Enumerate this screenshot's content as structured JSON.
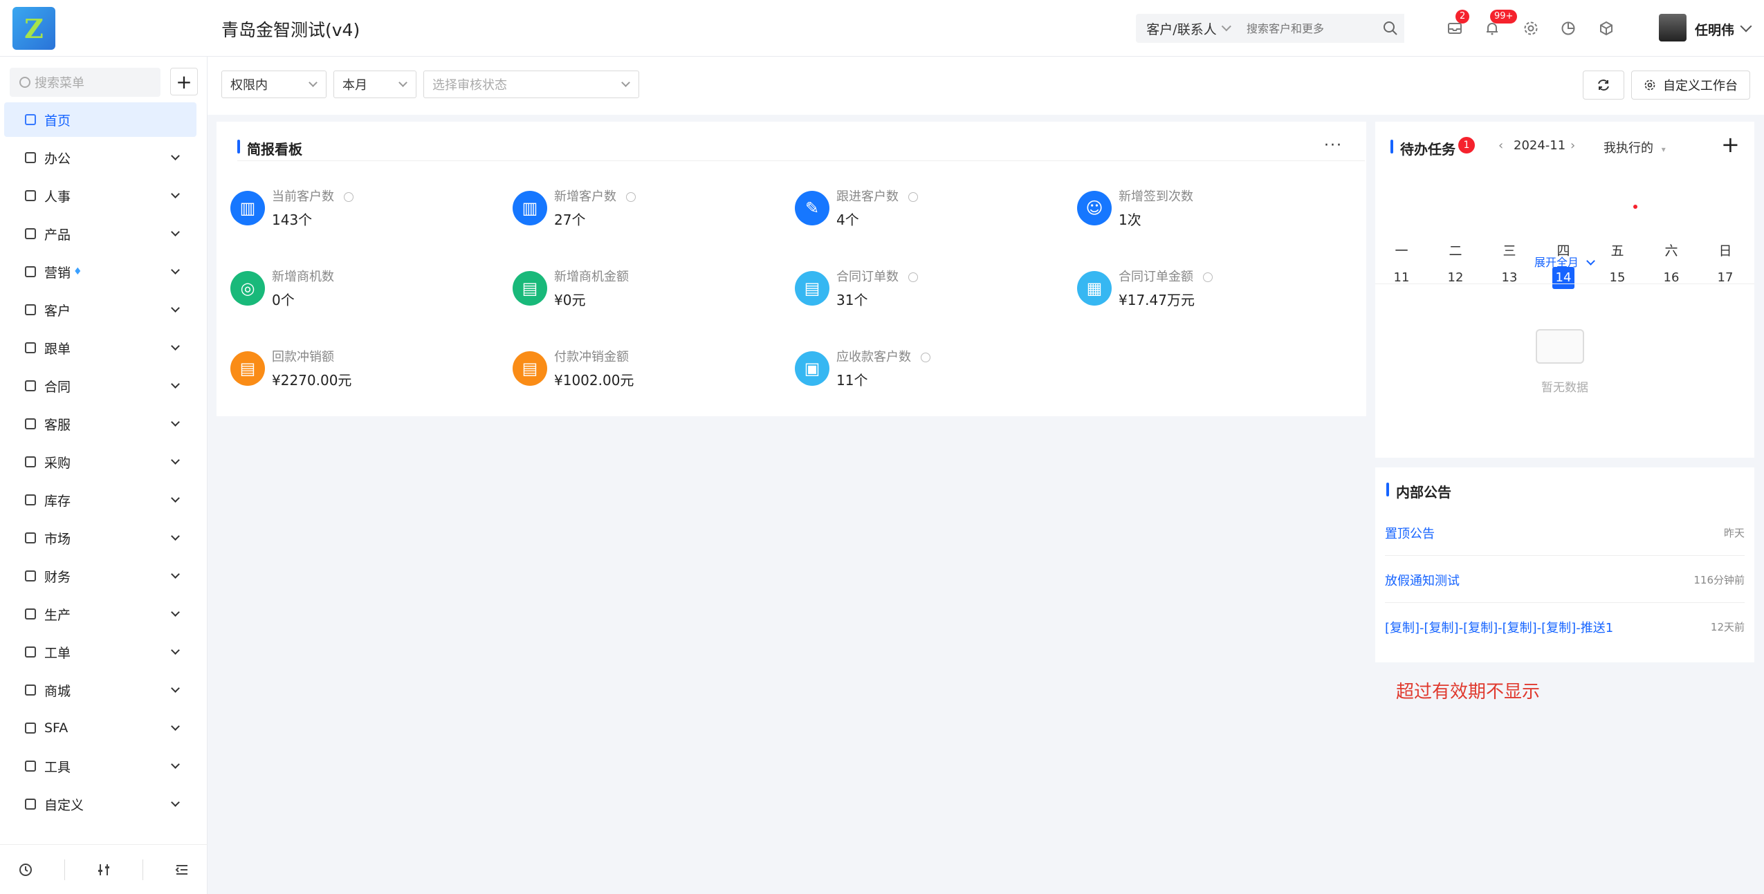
{
  "header": {
    "app_title": "青岛金智测试(v4)",
    "search_scope": "客户/联系人",
    "search_placeholder": "搜索客户和更多",
    "mail_badge": "2",
    "bell_badge": "99+",
    "user_name": "任明伟"
  },
  "sidebar": {
    "search_placeholder": "搜索菜单",
    "items": [
      {
        "label": "首页",
        "active": true,
        "icon": "home-icon"
      },
      {
        "label": "办公",
        "icon": "office-icon"
      },
      {
        "label": "人事",
        "icon": "people-icon"
      },
      {
        "label": "产品",
        "icon": "product-icon"
      },
      {
        "label": "营销",
        "icon": "marketing-icon"
      },
      {
        "label": "客户",
        "icon": "customer-icon"
      },
      {
        "label": "跟单",
        "icon": "follow-icon"
      },
      {
        "label": "合同",
        "icon": "contract-icon"
      },
      {
        "label": "客服",
        "icon": "service-icon"
      },
      {
        "label": "采购",
        "icon": "purchase-icon"
      },
      {
        "label": "库存",
        "icon": "inventory-icon"
      },
      {
        "label": "市场",
        "icon": "market-icon"
      },
      {
        "label": "财务",
        "icon": "finance-icon"
      },
      {
        "label": "生产",
        "icon": "production-icon"
      },
      {
        "label": "工单",
        "icon": "ticket-icon"
      },
      {
        "label": "商城",
        "icon": "mall-icon"
      },
      {
        "label": "SFA",
        "icon": "sfa-icon"
      },
      {
        "label": "工具",
        "icon": "tools-icon"
      },
      {
        "label": "自定义",
        "icon": "custom-icon"
      }
    ]
  },
  "filters": {
    "scope": "权限内",
    "period": "本月",
    "audit_placeholder": "选择审核状态",
    "customize_label": "自定义工作台"
  },
  "dashboard": {
    "title": "简报看板",
    "stats": [
      {
        "label": "当前客户数",
        "value": "143个",
        "color": "#1677ff",
        "icon": "building-icon"
      },
      {
        "label": "新增客户数",
        "value": "27个",
        "color": "#1677ff",
        "icon": "building-icon"
      },
      {
        "label": "跟进客户数",
        "value": "4个",
        "color": "#1677ff",
        "icon": "pen-icon"
      },
      {
        "label": "新增签到次数",
        "value": "1次",
        "color": "#1677ff",
        "icon": "team-icon"
      },
      {
        "label": "新增商机数",
        "value": "0个",
        "color": "#19b97a",
        "icon": "target-icon"
      },
      {
        "label": "新增商机金额",
        "value": "¥0元",
        "color": "#19b97a",
        "icon": "doc-icon"
      },
      {
        "label": "合同订单数",
        "value": "31个",
        "color": "#36b7f2",
        "icon": "doc-icon"
      },
      {
        "label": "合同订单金额",
        "value": "¥17.47万元",
        "color": "#36b7f2",
        "icon": "chart-icon"
      },
      {
        "label": "回款冲销额",
        "value": "¥2270.00元",
        "color": "#fa8c16",
        "icon": "doc-icon"
      },
      {
        "label": "付款冲销金额",
        "value": "¥1002.00元",
        "color": "#fa8c16",
        "icon": "doc-icon"
      },
      {
        "label": "应收款客户数",
        "value": "11个",
        "color": "#36b7f2",
        "icon": "clipboard-icon"
      }
    ]
  },
  "tasks": {
    "title": "待办任务",
    "badge": "1",
    "month": "2024-11",
    "filter": "我执行的",
    "weekdays": [
      "一",
      "二",
      "三",
      "四",
      "五",
      "六",
      "日"
    ],
    "days": [
      "11",
      "12",
      "13",
      "14",
      "15",
      "16",
      "17"
    ],
    "today_index": 3,
    "event_day_index": 4,
    "expand_label": "展开全月",
    "empty_text": "暂无数据"
  },
  "notices": {
    "title": "内部公告",
    "items": [
      {
        "title": "置顶公告",
        "time": "昨天"
      },
      {
        "title": "放假通知测试",
        "time": "116分钟前"
      },
      {
        "title": "[复制]-[复制]-[复制]-[复制]-[复制]-推送1",
        "time": "12天前"
      }
    ]
  },
  "annotation": "超过有效期不显示"
}
